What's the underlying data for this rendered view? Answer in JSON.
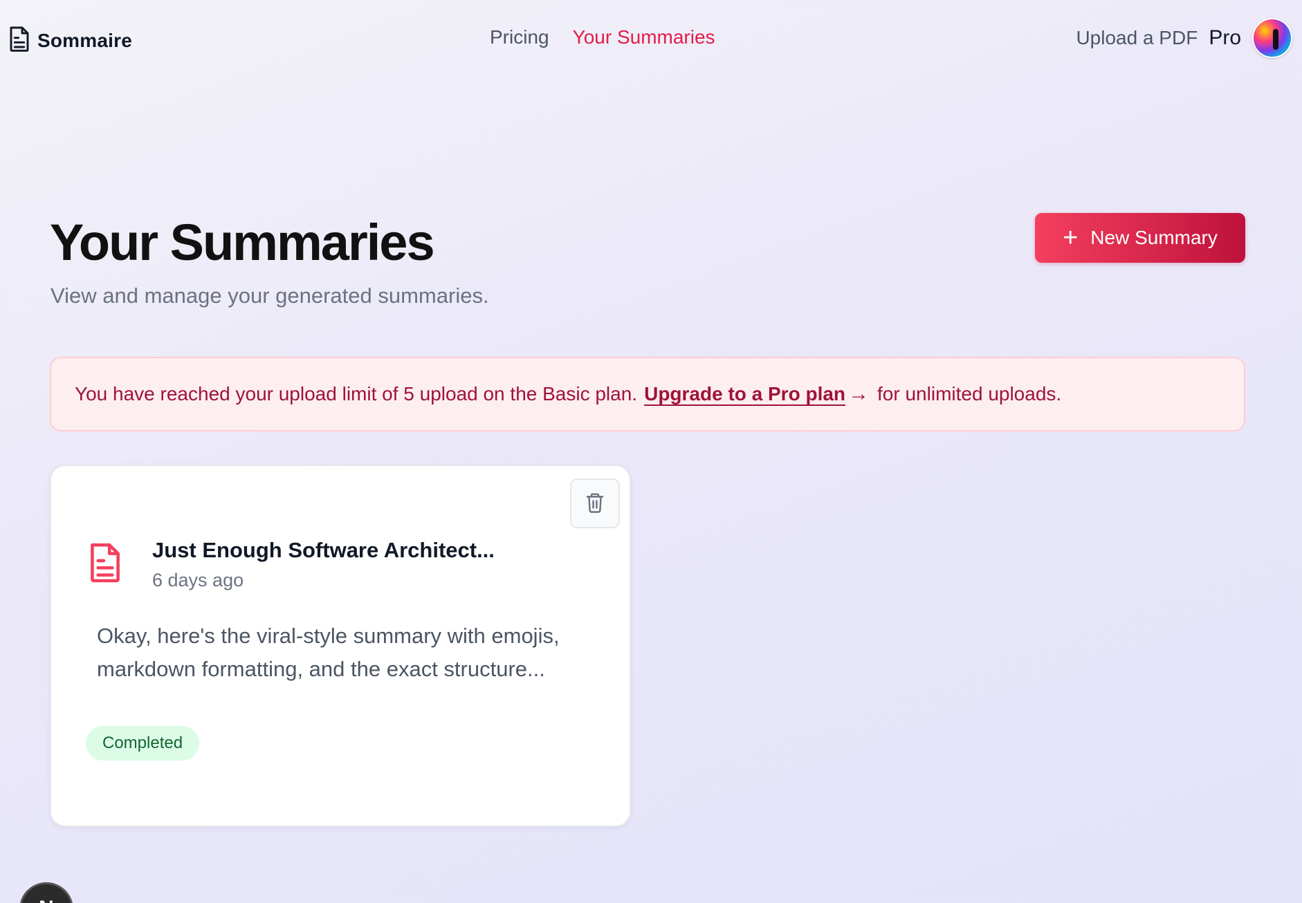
{
  "app": {
    "logo_text": "Sommaire"
  },
  "nav": {
    "items": [
      {
        "label": "Pricing"
      },
      {
        "label": "Your Summaries"
      }
    ]
  },
  "header_right": {
    "upload_label": "Upload a PDF",
    "plan_label": "Pro"
  },
  "main": {
    "title": "Your Summaries",
    "subtitle": "View and manage your generated summaries.",
    "new_summary_label": "New Summary"
  },
  "alert": {
    "text_before": "You have reached your upload limit of 5 upload on the Basic plan.",
    "link_text": "Upgrade to a Pro plan",
    "text_after": "for unlimited uploads."
  },
  "summaries": [
    {
      "title": "Just Enough Software Architect...",
      "time": "6 days ago",
      "excerpt": "Okay, here's the viral-style summary with emojis, markdown formatting, and the exact structure...",
      "status": "Completed"
    }
  ],
  "floating_badge": {
    "label": "N"
  },
  "colors": {
    "accent": "#e11d48",
    "button_start": "#f43f5e",
    "button_end": "#be123c",
    "alert_bg": "#fdeef0",
    "alert_text": "#9f1239",
    "status_bg": "#dcfce7",
    "status_text": "#166534"
  },
  "icons": {
    "logo": "file-text-icon",
    "delete": "trash-icon",
    "doc": "file-text-icon",
    "add": "plus-icon",
    "link": "arrow-right-icon"
  }
}
